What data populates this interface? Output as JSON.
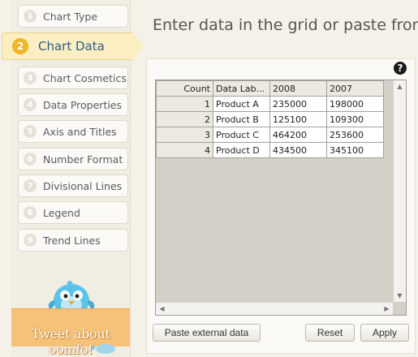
{
  "sidebar": {
    "steps": [
      {
        "num": "1",
        "label": "Chart Type"
      },
      {
        "num": "2",
        "label": "Chart Data"
      },
      {
        "num": "3",
        "label": "Chart Cosmetics"
      },
      {
        "num": "4",
        "label": "Data Properties"
      },
      {
        "num": "5",
        "label": "Axis and Titles"
      },
      {
        "num": "6",
        "label": "Number Format"
      },
      {
        "num": "7",
        "label": "Divisional Lines"
      },
      {
        "num": "8",
        "label": "Legend"
      },
      {
        "num": "9",
        "label": "Trend Lines"
      }
    ],
    "active_step": "2",
    "tweet": "Tweet about oomfo!"
  },
  "main": {
    "heading": "Enter data in the grid or paste from",
    "help": "?"
  },
  "grid": {
    "headers": [
      "Count",
      "Data Lab...",
      "2008",
      "2007"
    ],
    "rows": [
      {
        "num": "1",
        "label": "Product A",
        "v2008": "235000",
        "v2007": "198000"
      },
      {
        "num": "2",
        "label": "Product B",
        "v2008": "125100",
        "v2007": "109300"
      },
      {
        "num": "3",
        "label": "Product C",
        "v2008": "464200",
        "v2007": "253600"
      },
      {
        "num": "4",
        "label": "Product D",
        "v2008": "434500",
        "v2007": "345100"
      }
    ]
  },
  "buttons": {
    "paste": "Paste external data",
    "reset": "Reset",
    "apply": "Apply"
  },
  "colors": {
    "accent": "#f0b52a",
    "active_bg": "#fbeec0",
    "active_text": "#2f5c86"
  }
}
